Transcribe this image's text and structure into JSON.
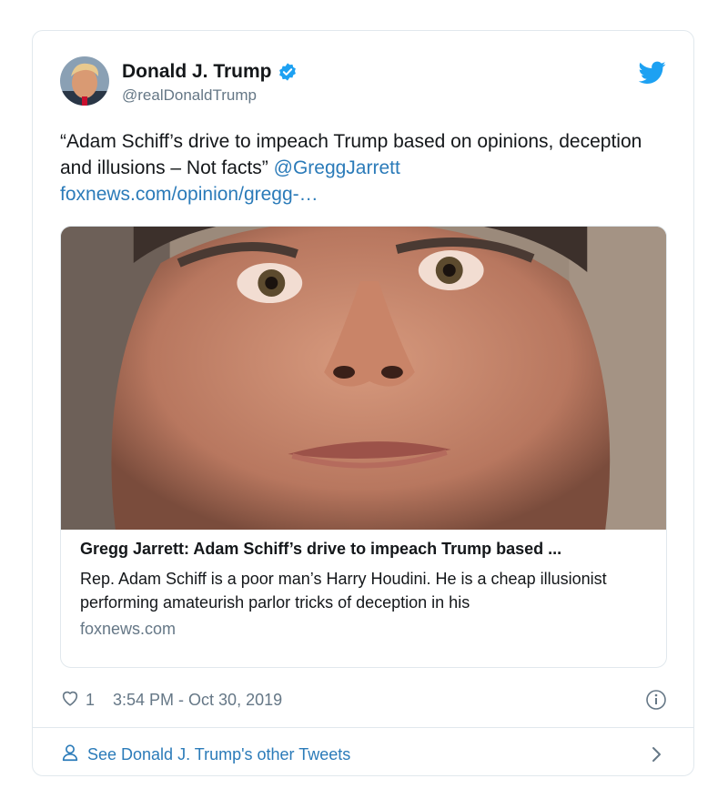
{
  "tweet": {
    "display_name": "Donald J. Trump",
    "handle": "@realDonaldTrump",
    "text_quote": "“Adam Schiff’s drive to impeach Trump based on opinions, deception and illusions – Not facts”",
    "mention": "@GreggJarrett",
    "link": "foxnews.com/opinion/gregg-…",
    "likes": "1",
    "timestamp": "3:54 PM - Oct 30, 2019"
  },
  "link_card": {
    "title": "Gregg Jarrett: Adam Schiff’s drive to impeach Trump based ...",
    "description": "Rep. Adam Schiff is a poor man’s Harry Houdini. He is a cheap illusionist performing amateurish parlor tricks of deception in his",
    "domain": "foxnews.com"
  },
  "footer": {
    "label": "See Donald J. Trump's other Tweets"
  },
  "icons": {
    "verified": "verified-badge-icon",
    "brand": "twitter-bird-icon",
    "like": "heart-icon",
    "info": "info-icon",
    "profile": "person-icon",
    "more": "chevron-right-icon"
  },
  "colors": {
    "brand_blue": "#1da1f2",
    "link_blue": "#2b7bb9",
    "secondary_text": "#657786",
    "border": "#e1e8ed"
  }
}
